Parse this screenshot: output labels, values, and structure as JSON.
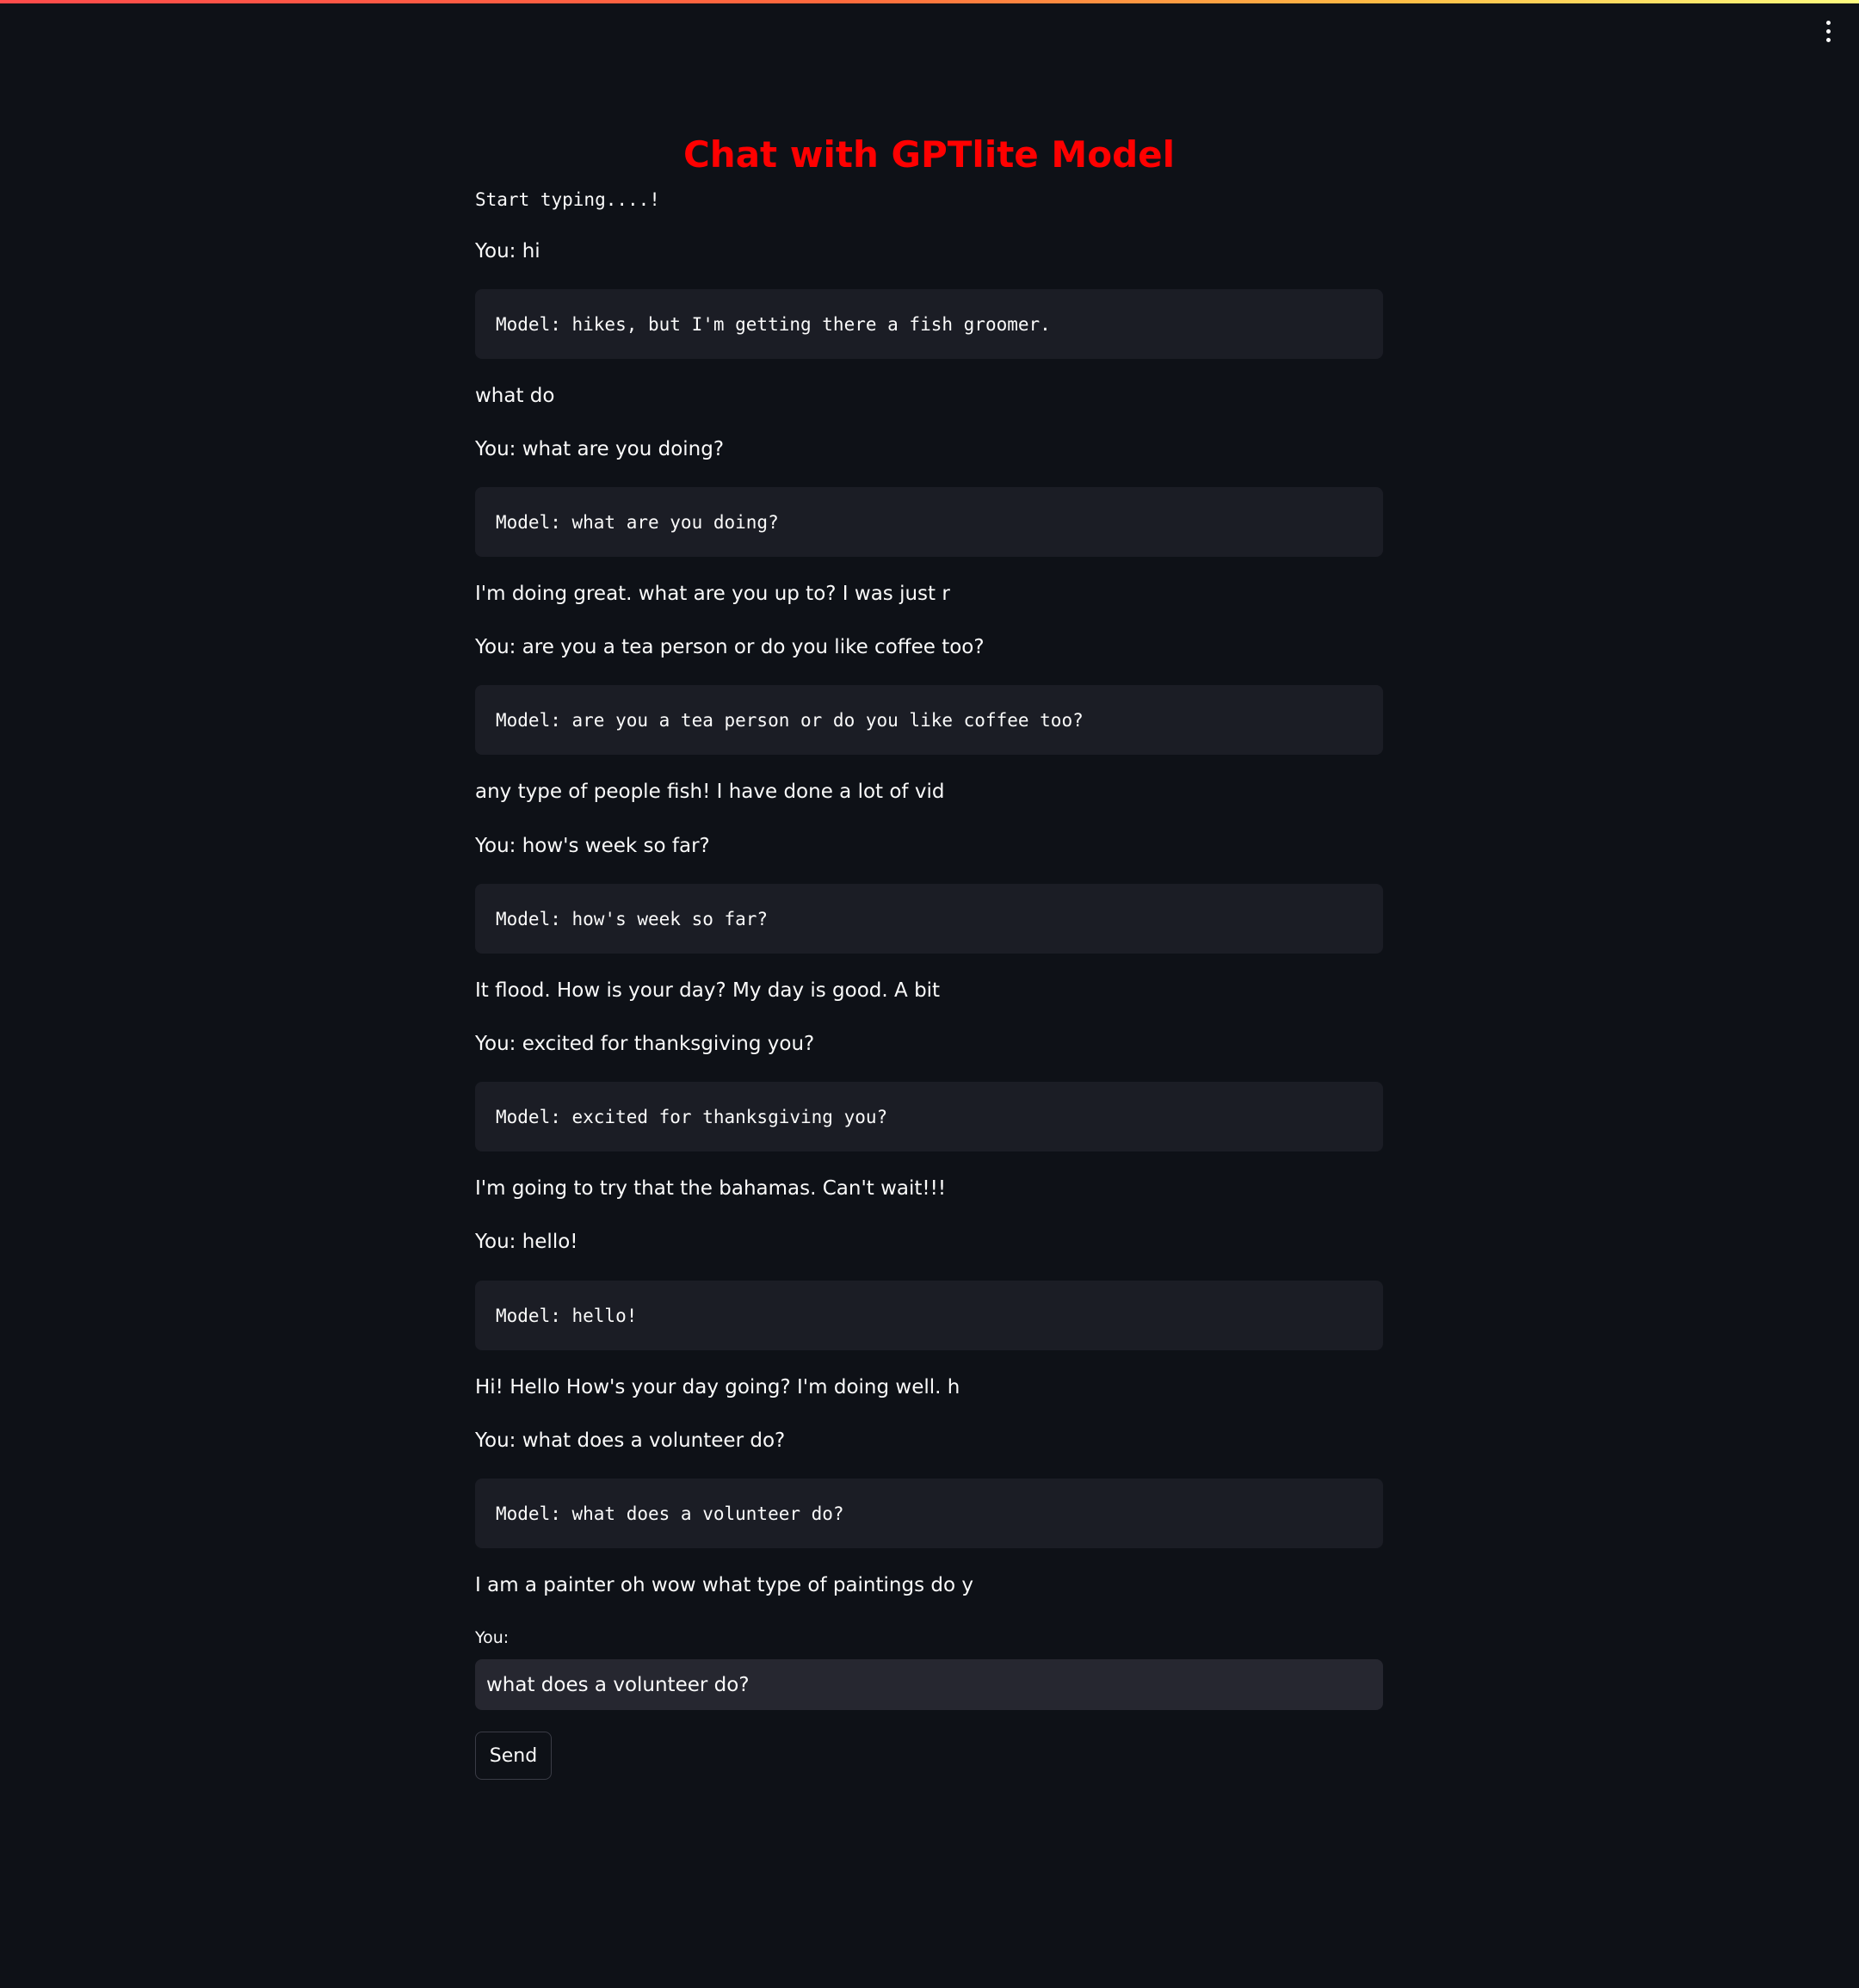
{
  "header": {
    "menu_icon": "kebab-vertical-icon",
    "accent_gradient": [
      "#ff4b4b",
      "#ffbd45",
      "#fffd80"
    ]
  },
  "main": {
    "title": "Chat with GPTlite Model",
    "intro": "Start typing....!",
    "messages": [
      {
        "user": "You: hi",
        "model": "Model: hikes, but I'm getting there a fish groomer.",
        "continuation": "what do"
      },
      {
        "user": "You: what are you doing?",
        "model": "Model: what are you doing?",
        "continuation": "I'm doing great. what are you up to? I was just r"
      },
      {
        "user": "You: are you a tea person or do you like coffee too?",
        "model": "Model: are you a tea person or do you like coffee too?",
        "continuation": "any type of people fish! I have done a lot of vid"
      },
      {
        "user": "You: how's week so far?",
        "model": "Model: how's week so far?",
        "continuation": "It flood. How is your day? My day is good. A bit"
      },
      {
        "user": "You: excited for thanksgiving you?",
        "model": "Model: excited for thanksgiving you?",
        "continuation": "I'm going to try that the bahamas. Can't wait!!!"
      },
      {
        "user": "You: hello!",
        "model": "Model: hello!",
        "continuation": "Hi! Hello How's your day going? I'm doing well. h"
      },
      {
        "user": "You: what does a volunteer do?",
        "model": "Model: what does a volunteer do?",
        "continuation": "I am a painter oh wow what type of paintings do y"
      }
    ]
  },
  "input": {
    "label": "You:",
    "value": "what does a volunteer do?"
  },
  "send_button": {
    "label": "Send"
  },
  "colors": {
    "background": "#0e1117",
    "title": "#ff0000",
    "code_block": "#1b1d25",
    "input": "#262730",
    "text": "#fafafa"
  }
}
